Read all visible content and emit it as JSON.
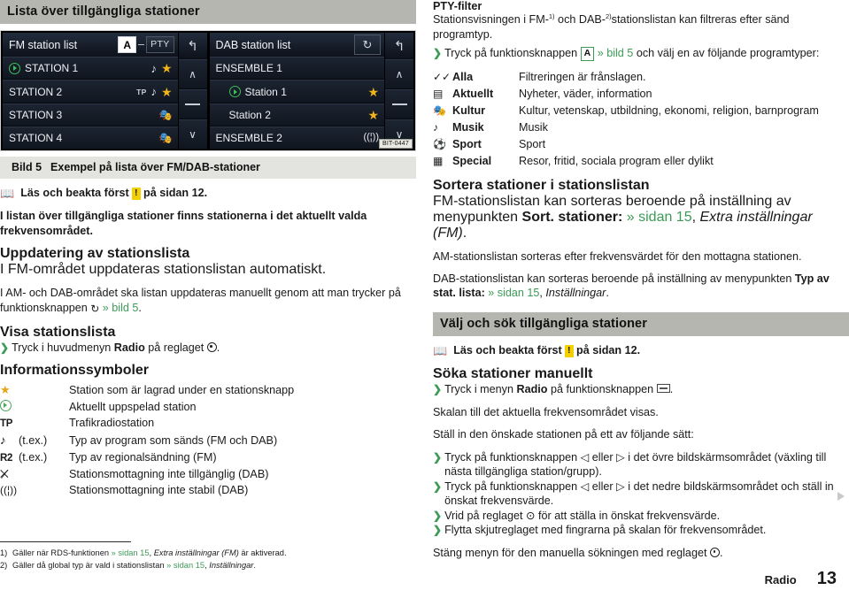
{
  "left": {
    "section_header": "Lista över tillgängliga stationer",
    "figure": {
      "fm": {
        "title": "FM station list",
        "btn_a": "A",
        "pty_label": "PTY",
        "back_icon": "back-arrow",
        "rows": [
          {
            "label": "STATION 1",
            "playing": true,
            "tp": "",
            "note": true,
            "star": true,
            "masks": false
          },
          {
            "label": "STATION 2",
            "playing": false,
            "tp": "TP",
            "note": true,
            "star": true,
            "masks": false
          },
          {
            "label": "STATION 3",
            "playing": false,
            "tp": "",
            "note": false,
            "star": false,
            "masks": true
          },
          {
            "label": "STATION 4",
            "playing": false,
            "tp": "",
            "note": false,
            "star": false,
            "masks": true
          }
        ],
        "side": {
          "up": "∧",
          "mid": "bar",
          "down": "∨"
        }
      },
      "dab": {
        "title": "DAB station list",
        "refresh_icon": "refresh-icon",
        "back_icon": "back-arrow",
        "rows": [
          {
            "label": "ENSEMBLE 1",
            "indent": false,
            "playing": false,
            "star": false,
            "ant": false
          },
          {
            "label": "Station 1",
            "indent": true,
            "playing": true,
            "star": true,
            "ant": false
          },
          {
            "label": "Station 2",
            "indent": true,
            "playing": false,
            "star": true,
            "ant": false
          },
          {
            "label": "ENSEMBLE 2",
            "indent": false,
            "playing": false,
            "star": false,
            "ant": true
          }
        ],
        "side": {
          "up": "∧",
          "mid": "bar",
          "down": "∨"
        }
      },
      "bit_code": "BIT-0447",
      "caption_num": "Bild 5",
      "caption_text": "Exempel på lista över FM/DAB-stationer"
    },
    "read_note": {
      "pre": "Läs och beakta först",
      "badge": "!",
      "post": "på sidan 12."
    },
    "intro": "I listan över tillgängliga stationer finns stationerna i det aktuellt valda frekvensområdet.",
    "update": {
      "heading": "Uppdatering av stationslista",
      "line1": "I FM-området uppdateras stationslistan automatiskt.",
      "line2_a": "I AM- och DAB-området ska listan uppdateras manuellt genom att man trycker på funktionsknappen",
      "line2_link": "» bild 5",
      "line2_end": "."
    },
    "show_list": {
      "heading": "Visa stationslista",
      "bullet_a": "Tryck i huvudmenyn",
      "bullet_b": "Radio",
      "bullet_c": "på reglaget",
      "bullet_end": "."
    },
    "symbols": {
      "heading": "Informationssymboler",
      "rows": [
        {
          "glyph": "star-icon",
          "suffix": "",
          "desc": "Station som är lagrad under en stationsknapp"
        },
        {
          "glyph": "play-circle-icon",
          "suffix": "",
          "desc": "Aktuellt uppspelad station"
        },
        {
          "glyph": "TP",
          "suffix": "",
          "desc": "Trafikradiostation"
        },
        {
          "glyph": "music-note-icon",
          "suffix": "(t.ex.)",
          "desc": "Typ av program som sänds (FM och DAB)"
        },
        {
          "glyph": "R2",
          "suffix": "(t.ex.)",
          "desc": "Typ av regionalsändning (FM)"
        },
        {
          "glyph": "antenna-off-icon",
          "suffix": "",
          "desc": "Stationsmottagning inte tillgänglig (DAB)"
        },
        {
          "glyph": "antenna-weak-icon",
          "suffix": "",
          "desc": "Stationsmottagning inte stabil (DAB)"
        }
      ]
    },
    "footnotes": [
      {
        "num": "1)",
        "pre": "Gäller när RDS-funktionen",
        "link": "» sidan 15",
        "mid": ",",
        "italic": "Extra inställningar (FM)",
        "post": "är aktiverad."
      },
      {
        "num": "2)",
        "pre": "Gäller då global typ är vald i stationslistan",
        "link": "» sidan 15",
        "mid": ",",
        "italic": "Inställningar",
        "post": "."
      }
    ]
  },
  "right": {
    "pty": {
      "heading": "PTY-filter",
      "intro_a": "Stationsvisningen i FM-",
      "sup1": "1)",
      "intro_b": " och DAB-",
      "sup2": "2)",
      "intro_c": "stationslistan kan filtreras efter sänd programtyp.",
      "bullet_a": "Tryck på funktionsknappen",
      "bullet_key": "A",
      "bullet_link": "» bild 5",
      "bullet_b": "och välj en av följande programtyper:",
      "types": [
        {
          "icon": "double-check-icon",
          "name": "Alla",
          "desc": "Filtreringen är frånslagen."
        },
        {
          "icon": "document-icon",
          "name": "Aktuellt",
          "desc": "Nyheter, väder, information"
        },
        {
          "icon": "theater-masks-icon",
          "name": "Kultur",
          "desc": "Kultur, vetenskap, utbildning, ekonomi, religion, barnprogram"
        },
        {
          "icon": "music-note-icon",
          "name": "Musik",
          "desc": "Musik"
        },
        {
          "icon": "soccer-ball-icon",
          "name": "Sport",
          "desc": "Sport"
        },
        {
          "icon": "grid-icon",
          "name": "Special",
          "desc": "Resor, fritid, sociala program eller dylikt"
        }
      ]
    },
    "sort": {
      "heading": "Sortera stationer i stationslistan",
      "p1_a": "FM-stationslistan kan sorteras beroende på inställning av menypunkten",
      "p1_bold": "Sort. stationer:",
      "p1_link": "» sidan 15",
      "p1_italic": "Extra inställningar (FM)",
      "p1_end": ".",
      "p2": "AM-stationslistan sorteras efter frekvensvärdet för den mottagna stationen.",
      "p3_a": "DAB-stationslistan kan sorteras beroende på inställning av menypunkten",
      "p3_bold": "Typ av stat. lista:",
      "p3_link": "» sidan 15",
      "p3_italic": "Inställningar",
      "p3_end": "."
    },
    "select": {
      "section_header": "Välj och sök tillgängliga stationer",
      "read_note": {
        "pre": "Läs och beakta först",
        "badge": "!",
        "post": "på sidan 12."
      },
      "manual": {
        "heading": "Söka stationer manuellt",
        "bullet_a": "Tryck i menyn",
        "bullet_bold": "Radio",
        "bullet_b": "på funktionsknappen",
        "bullet_end": "."
      },
      "scale_line": "Skalan till det aktuella frekvensområdet visas.",
      "set_line": "Ställ in den önskade stationen på ett av följande sätt:",
      "bullets": [
        "Tryck på funktionsknappen ◁ eller ▷ i det övre bildskärmsområdet (växling till nästa tillgängliga station/grupp).",
        "Tryck på funktionsknappen ◁ eller ▷ i det nedre bildskärmsområdet och ställ in önskat frekvensvärde.",
        "Vrid på reglaget ⊙ för att ställa in önskat frekvensvärde.",
        "Flytta skjutreglaget med fingrarna på skalan för frekvensområdet."
      ],
      "close_a": "Stäng menyn för den manuella sökningen med reglaget",
      "close_end": "."
    }
  },
  "footer": {
    "section": "Radio",
    "page": "13"
  }
}
